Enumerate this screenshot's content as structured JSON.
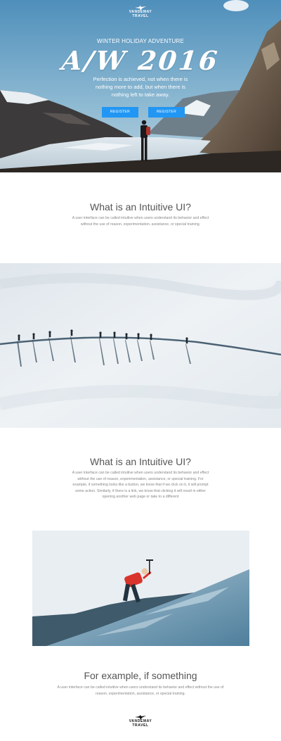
{
  "brand": {
    "line1": "VANDEMAY",
    "line2": "TRAVEL"
  },
  "hero": {
    "eyebrow": "WINTER HOLIDAY ADVENTURE",
    "title": "A/W 2016",
    "quote": "Perfection is achieved, not when there is nothing more to add, but when there is nothing left to take away.",
    "buttons": [
      "REGISTER",
      "REGISTER"
    ]
  },
  "section1": {
    "title": "What is an Intuitive UI?",
    "text": "A user interface can be called intuitive when users understand its behavior and effect without the use of reason, experimentation, assistance, or special training."
  },
  "section2": {
    "title": "What is an Intuitive UI?",
    "text": "A user interface can be called intuitive when users understand its behavior and effect without the use of reason, experimentation, assistance, or special training. For example, if something looks like a button, we know that if we click on it, it will prompt some action. Similarly, if there is a link, we know that clicking it will result in either opening another web page or take to a different"
  },
  "section3": {
    "title": "For example, if something",
    "text": "A user interface can be called intuitive when users understand its behavior and effect without the use of reason, experimentation, assistance, or special training."
  },
  "colors": {
    "accent": "#2196f3",
    "sky": "#6fa6c7",
    "snow": "#e9eef3"
  }
}
